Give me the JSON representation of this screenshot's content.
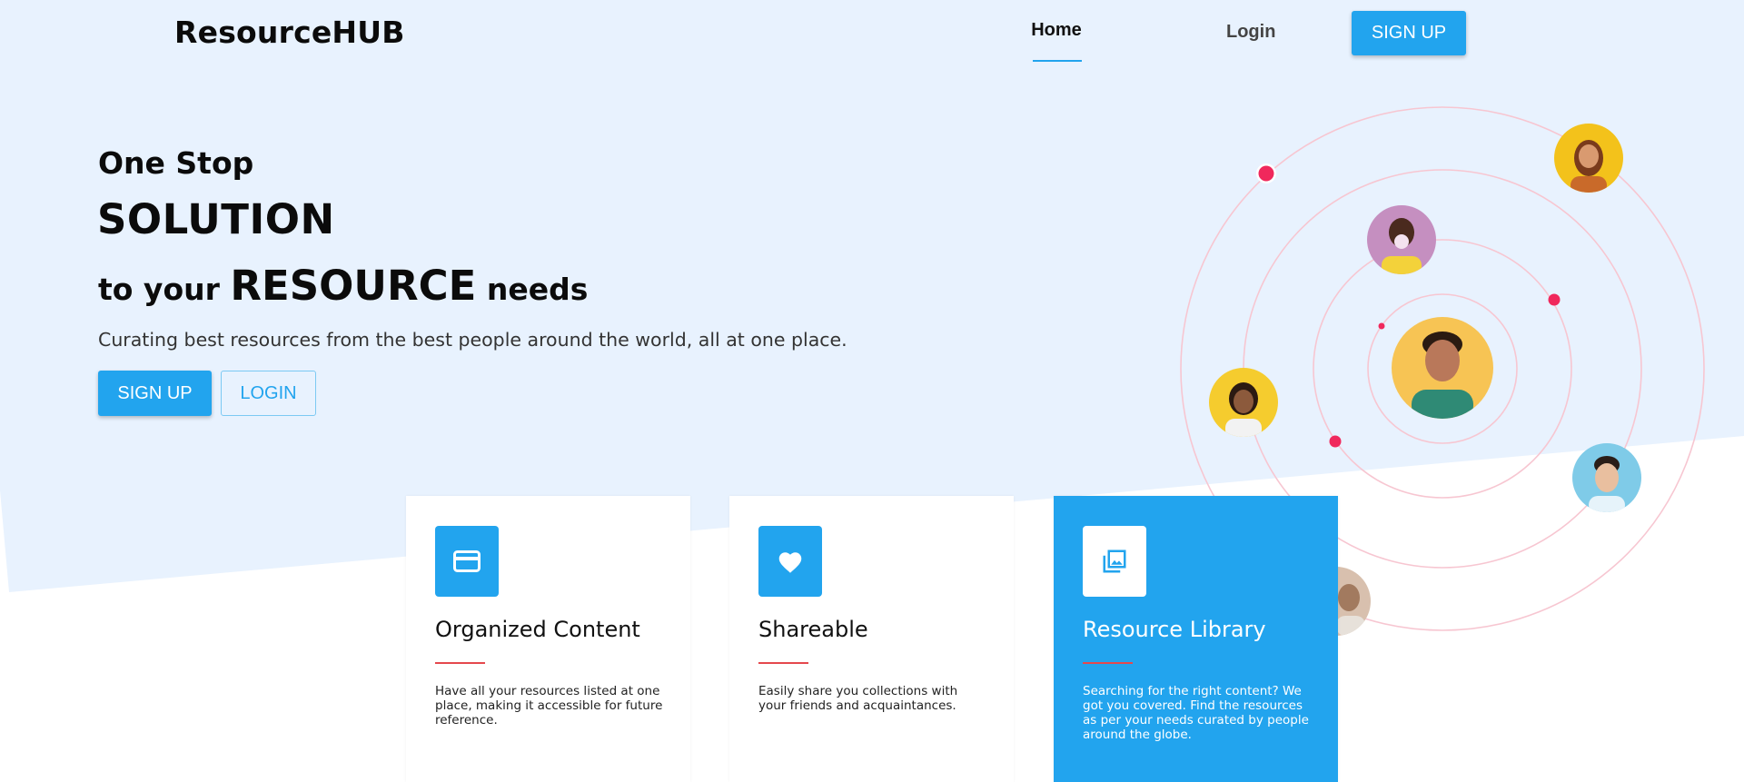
{
  "header": {
    "brand": "ResourceHUB",
    "nav": {
      "home_label": "Home",
      "login_label": "Login",
      "signup_label": "SIGN UP"
    }
  },
  "hero": {
    "line1": "One Stop",
    "line2": "SOLUTION",
    "line3_pre": "to your ",
    "line3_big": "RESOURCE",
    "line3_post": " needs",
    "subtitle": "Curating best resources from the best people around the world, all at one place.",
    "signup_label": "SIGN UP",
    "login_label": "LOGIN"
  },
  "features": [
    {
      "icon": "credit-card-icon",
      "title": "Organized Content",
      "text": "Have all your resources listed at one place, making it accessible for future reference."
    },
    {
      "icon": "heart-icon",
      "title": "Shareable",
      "text": "Easily share you collections with your friends and acquaintances."
    },
    {
      "icon": "photo-library-icon",
      "title": "Resource Library",
      "text": "Searching for the right content? We got you covered. Find the resources as per your needs curated by people around the globe."
    }
  ],
  "colors": {
    "accent": "#22a4ee",
    "hero_bg": "#e8f2fe",
    "orbit_line": "#f7c6d1",
    "dot": "#f0285c",
    "card_rule": "#e5484d"
  },
  "illustration": {
    "avatars": [
      "avatar-woman-yellow",
      "avatar-bubblegum",
      "avatar-main-man",
      "avatar-woman-left",
      "avatar-man-right",
      "avatar-partial-bottom"
    ]
  }
}
